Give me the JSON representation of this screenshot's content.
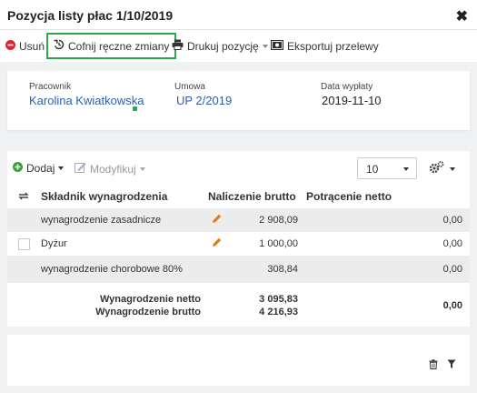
{
  "window": {
    "title": "Pozycja listy płac 1/10/2019",
    "close_glyph": "✖"
  },
  "toolbar": {
    "delete_label": "Usuń",
    "undo_label": "Cofnij ręczne zmiany",
    "print_label": "Drukuj pozycję",
    "export_label": "Eksportuj przelewy"
  },
  "info": {
    "employee_label": "Pracownik",
    "employee_value": "Karolina Kwiatkowska",
    "contract_label": "Umowa",
    "contract_value": "UP 2/2019",
    "payout_label": "Data wypłaty",
    "payout_value": "2019-11-10"
  },
  "grid": {
    "add_label": "Dodaj",
    "modify_label": "Modyfikuj",
    "page_size": "10",
    "columns": {
      "component": "Składnik wynagrodzenia",
      "accrual": "Naliczenie brutto",
      "deduction": "Potrącenie netto"
    },
    "rows": [
      {
        "name": "wynagrodzenie zasadnicze",
        "accrual": "2 908,09",
        "deduction": "0,00"
      },
      {
        "name": "Dyżur",
        "accrual": "1 000,00",
        "deduction": "0,00"
      },
      {
        "name": "wynagrodzenie chorobowe 80%",
        "accrual": "308,84",
        "deduction": "0,00"
      }
    ],
    "summary": {
      "net_label": "Wynagrodzenie netto",
      "net_value": "3 095,83",
      "gross_label": "Wynagrodzenie brutto",
      "gross_value": "4 216,93",
      "deduction_total": "0,00"
    }
  },
  "colors": {
    "accent_blue": "#2b5fb3",
    "highlight_green": "#2ea84a",
    "delete_red": "#d9272e",
    "edit_orange": "#e07b16"
  }
}
